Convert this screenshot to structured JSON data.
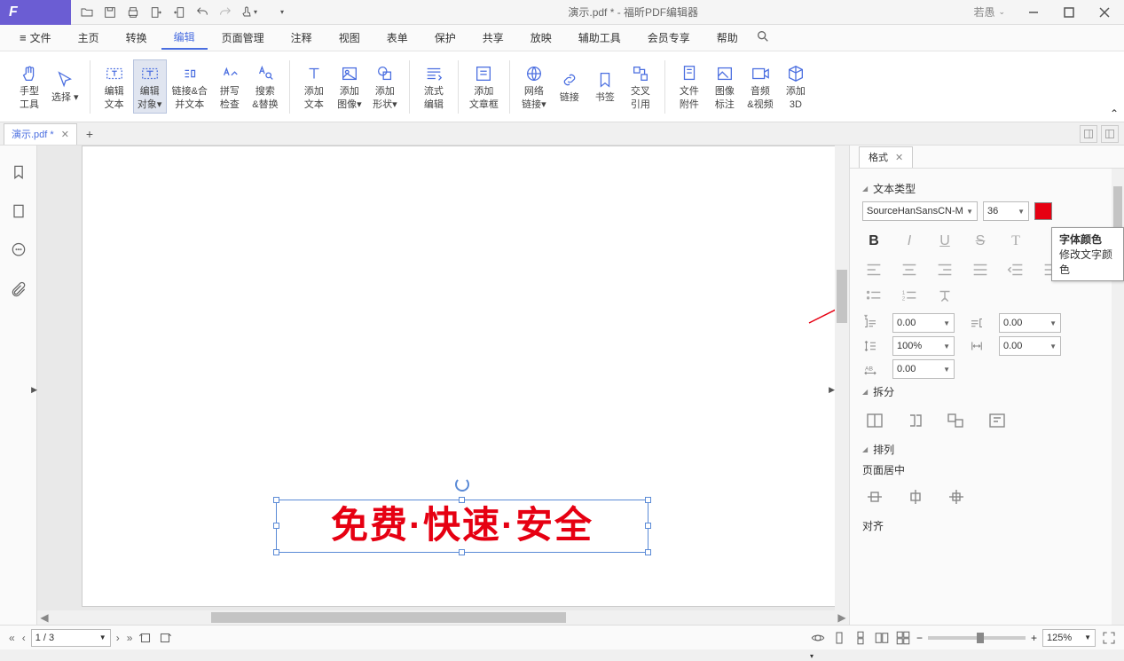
{
  "titlebar": {
    "doc_title": "演示.pdf * - 福昕PDF编辑器",
    "user": "若愚"
  },
  "menu": {
    "file": "文件",
    "home": "主页",
    "convert": "转换",
    "edit": "编辑",
    "pages": "页面管理",
    "comment": "注释",
    "view": "视图",
    "form": "表单",
    "protect": "保护",
    "share": "共享",
    "play": "放映",
    "tools": "辅助工具",
    "vip": "会员专享",
    "help": "帮助"
  },
  "ribbon": {
    "hand": "手型\n工具",
    "select": "选择",
    "edit_text": "编辑\n文本",
    "edit_obj": "编辑\n对象",
    "link_merge": "链接&合\n并文本",
    "spell": "拼写\n检查",
    "search": "搜索\n&替换",
    "add_text": "添加\n文本",
    "add_img": "添加\n图像",
    "add_shape": "添加\n形状",
    "flow": "流式\n编辑",
    "article": "添加\n文章框",
    "weblink": "网络\n链接",
    "link": "链接",
    "bookmark": "书签",
    "xref": "交叉\n引用",
    "attach": "文件\n附件",
    "img_annot": "图像\n标注",
    "av": "音频\n&视频",
    "add3d": "添加\n3D"
  },
  "tab": {
    "name": "演示.pdf *"
  },
  "format": {
    "tab": "格式",
    "text_type": "文本类型",
    "font": "SourceHanSansCN-M",
    "size": "36",
    "tooltip_title": "字体颜色",
    "tooltip_desc": "修改文字颜色",
    "split": "拆分",
    "arrange": "排列",
    "page_center": "页面居中",
    "align": "对齐",
    "spacing": {
      "indent_l": "0.00",
      "indent_r": "0.00",
      "line": "100%",
      "char": "0.00",
      "ab": "0.00"
    }
  },
  "canvas": {
    "text": "免费·快速·安全"
  },
  "status": {
    "page": "1 / 3",
    "zoom": "125%"
  }
}
